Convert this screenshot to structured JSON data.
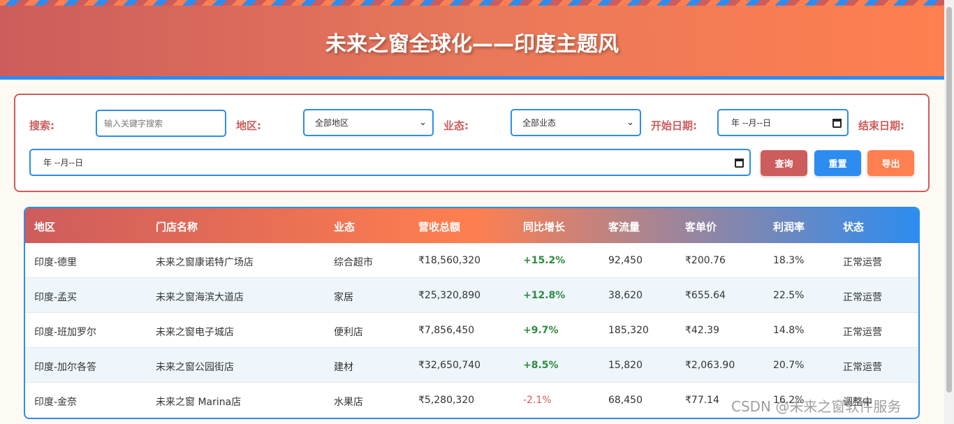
{
  "header": {
    "title": "未来之窗全球化——印度主题风"
  },
  "filters": {
    "search_label": "搜索:",
    "search_placeholder": "输入关键字搜索",
    "region_label": "地区:",
    "region_value": "全部地区",
    "format_label": "业态:",
    "format_value": "全部业态",
    "start_date_label": "开始日期:",
    "start_date_value": "年 --月--日",
    "end_date_label": "结束日期:",
    "end_date_value": "年 --月--日",
    "query_button": "查询",
    "reset_button": "重置",
    "export_button": "导出"
  },
  "table": {
    "columns": [
      "地区",
      "门店名称",
      "业态",
      "营收总额",
      "同比增长",
      "客流量",
      "客单价",
      "利润率",
      "状态"
    ],
    "rows": [
      [
        "印度-德里",
        "未来之窗康诺特广场店",
        "综合超市",
        "₹18,560,320",
        "+15.2%",
        "92,450",
        "₹200.76",
        "18.3%",
        "正常运营"
      ],
      [
        "印度-孟买",
        "未来之窗海滨大道店",
        "家居",
        "₹25,320,890",
        "+12.8%",
        "38,620",
        "₹655.64",
        "22.5%",
        "正常运营"
      ],
      [
        "印度-班加罗尔",
        "未来之窗电子城店",
        "便利店",
        "₹7,856,450",
        "+9.7%",
        "185,320",
        "₹42.39",
        "14.8%",
        "正常运营"
      ],
      [
        "印度-加尔各答",
        "未来之窗公园街店",
        "建材",
        "₹32,650,740",
        "+8.5%",
        "15,820",
        "₹2,063.90",
        "20.7%",
        "正常运营"
      ],
      [
        "印度-金奈",
        "未来之窗 Marina店",
        "水果店",
        "₹5,280,320",
        "-2.1%",
        "68,450",
        "₹77.14",
        "16.2%",
        "调整中"
      ]
    ]
  },
  "watermark": "CSDN @未来之窗软件服务",
  "colors": {
    "primary": "#cd5c5c",
    "accent": "#ff7f50",
    "blue": "#2d8cf0",
    "positive": "#2e8b3e"
  }
}
